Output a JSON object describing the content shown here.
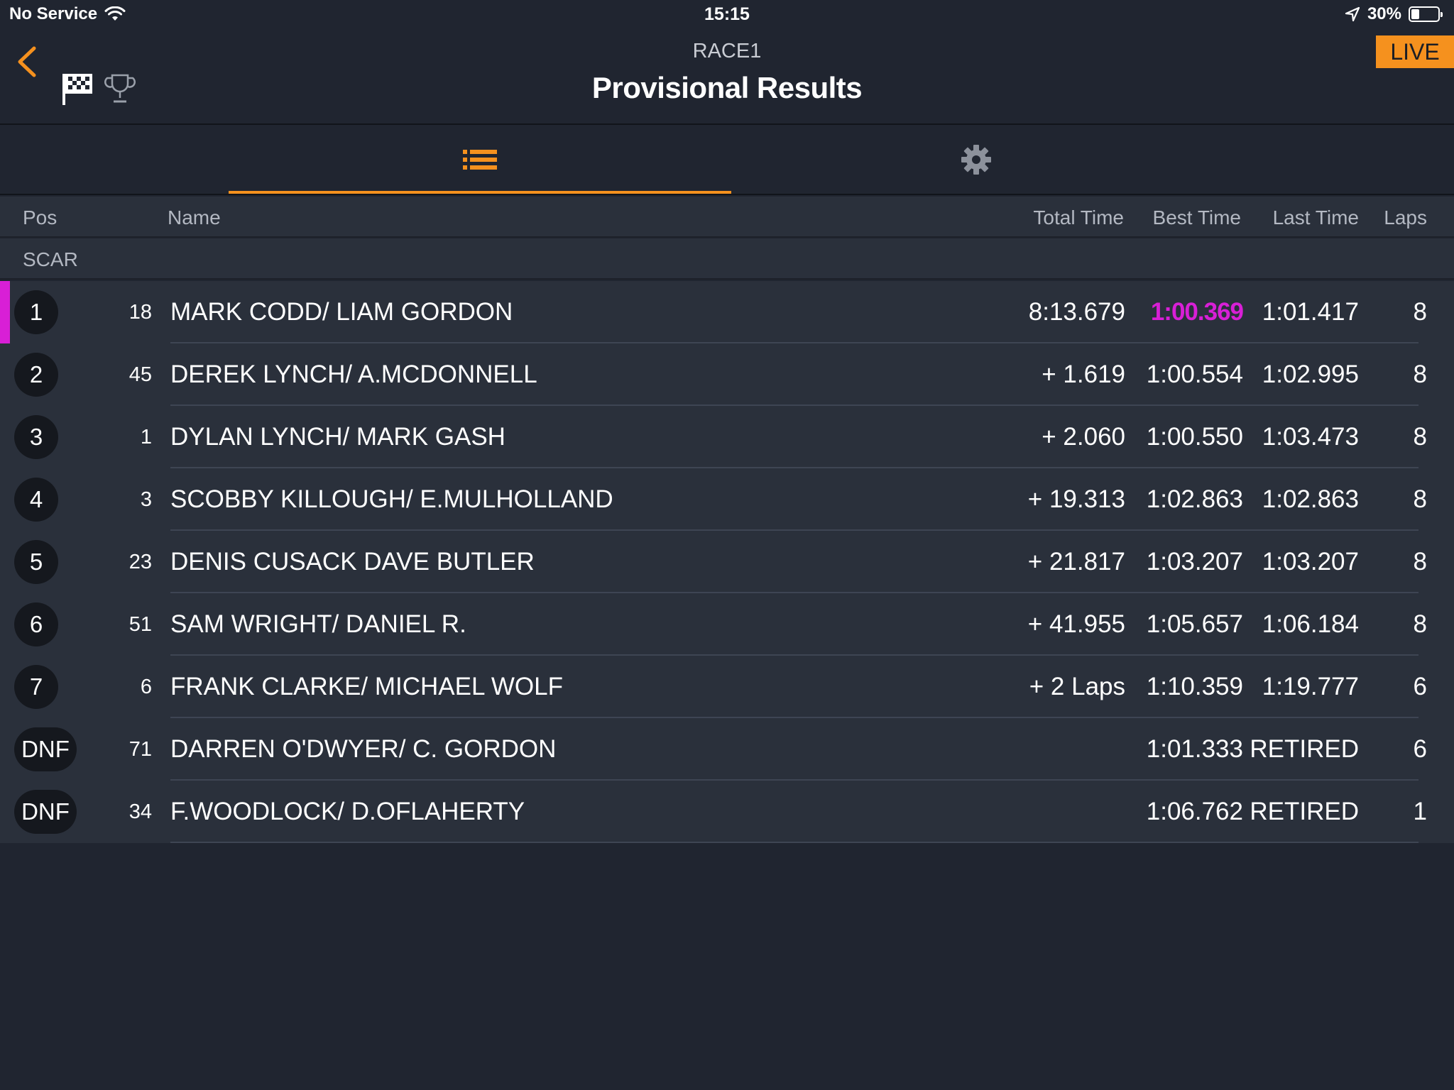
{
  "status_bar": {
    "carrier": "No Service",
    "time": "15:15",
    "battery_percent": "30%",
    "battery_level": 0.3
  },
  "header": {
    "race_name": "RACE1",
    "title": "Provisional Results",
    "live_label": "LIVE"
  },
  "tabs": [
    {
      "id": "results-list",
      "icon": "list-icon",
      "active": true
    },
    {
      "id": "settings",
      "icon": "gear-icon",
      "active": false
    }
  ],
  "columns": {
    "pos": "Pos",
    "name": "Name",
    "total_time": "Total Time",
    "best_time": "Best Time",
    "last_time": "Last Time",
    "laps": "Laps"
  },
  "group_label": "SCAR",
  "colors": {
    "accent": "#f5911e",
    "fastest": "#d81fd6",
    "background": "#202530",
    "row": "#2a303b"
  },
  "results": [
    {
      "pos": "1",
      "num": "18",
      "name": "MARK CODD/ LIAM GORDON",
      "total": "8:13.679",
      "best": "1:00.369",
      "last": "1:01.417",
      "laps": "8",
      "fastest": true
    },
    {
      "pos": "2",
      "num": "45",
      "name": "DEREK LYNCH/ A.MCDONNELL",
      "total": "+ 1.619",
      "best": "1:00.554",
      "last": "1:02.995",
      "laps": "8"
    },
    {
      "pos": "3",
      "num": "1",
      "name": "DYLAN LYNCH/ MARK GASH",
      "total": "+ 2.060",
      "best": "1:00.550",
      "last": "1:03.473",
      "laps": "8"
    },
    {
      "pos": "4",
      "num": "3",
      "name": "SCOBBY KILLOUGH/ E.MULHOLLAND",
      "total": "+ 19.313",
      "best": "1:02.863",
      "last": "1:02.863",
      "laps": "8"
    },
    {
      "pos": "5",
      "num": "23",
      "name": "DENIS CUSACK DAVE BUTLER",
      "total": "+ 21.817",
      "best": "1:03.207",
      "last": "1:03.207",
      "laps": "8"
    },
    {
      "pos": "6",
      "num": "51",
      "name": "SAM WRIGHT/ DANIEL R.",
      "total": "+ 41.955",
      "best": "1:05.657",
      "last": "1:06.184",
      "laps": "8"
    },
    {
      "pos": "7",
      "num": "6",
      "name": "FRANK CLARKE/ MICHAEL WOLF",
      "total": "+ 2 Laps",
      "best": "1:10.359",
      "last": "1:19.777",
      "laps": "6"
    },
    {
      "pos": "DNF",
      "num": "71",
      "name": "DARREN O'DWYER/ C. GORDON",
      "total": "",
      "best": "1:01.333",
      "last": "RETIRED",
      "laps": "6"
    },
    {
      "pos": "DNF",
      "num": "34",
      "name": "F.WOODLOCK/ D.OFLAHERTY",
      "total": "",
      "best": "1:06.762",
      "last": "RETIRED",
      "laps": "1"
    }
  ]
}
